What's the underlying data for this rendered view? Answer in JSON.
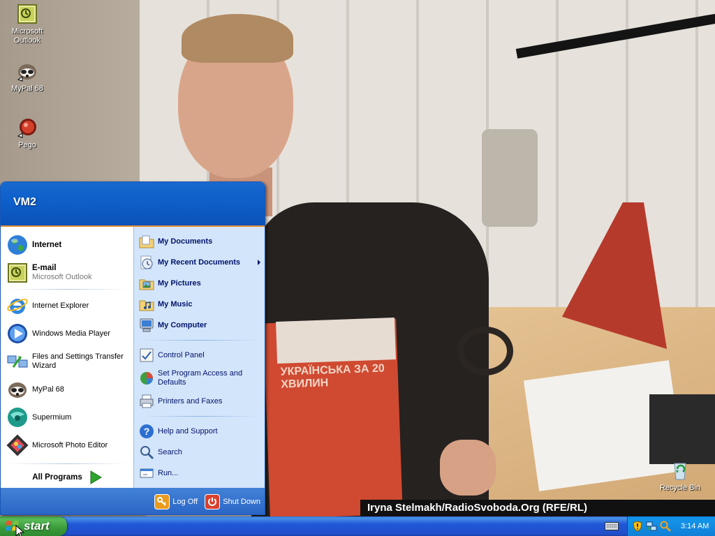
{
  "desktop": {
    "wallpaper_caption": "Iryna Stelmakh/RadioSvoboda.Org (RFE/RL)",
    "wallpaper_book_title": "УКРАЇНСЬКА ЗА 20 ХВИЛИН",
    "icons": [
      {
        "label": "Microsoft Outlook",
        "icon": "outlook-icon"
      },
      {
        "label": "MyPal 68",
        "icon": "mypal-icon"
      },
      {
        "label": "Pego",
        "icon": "pego-icon"
      },
      {
        "label": "Recycle Bin",
        "icon": "recycle-bin-icon"
      }
    ]
  },
  "start_menu": {
    "user_name": "VM2",
    "pinned": [
      {
        "label": "Internet",
        "icon": "globe-icon"
      },
      {
        "label": "E-mail",
        "sublabel": "Microsoft Outlook",
        "icon": "outlook-icon"
      }
    ],
    "recent": [
      {
        "label": "Internet Explorer",
        "icon": "internet-explorer-icon"
      },
      {
        "label": "Windows Media Player",
        "icon": "media-player-icon"
      },
      {
        "label": "Files and Settings Transfer Wizard",
        "icon": "transfer-wizard-icon"
      },
      {
        "label": "MyPal 68",
        "icon": "mypal-icon"
      },
      {
        "label": "Supermium",
        "icon": "supermium-icon"
      },
      {
        "label": "Microsoft Photo Editor",
        "icon": "photo-editor-icon"
      }
    ],
    "all_programs": "All Programs",
    "places": [
      {
        "label": "My Documents",
        "icon": "my-documents-icon"
      },
      {
        "label": "My Recent Documents",
        "icon": "recent-documents-icon",
        "submenu": true
      },
      {
        "label": "My Pictures",
        "icon": "my-pictures-icon"
      },
      {
        "label": "My Music",
        "icon": "my-music-icon"
      },
      {
        "label": "My Computer",
        "icon": "my-computer-icon"
      }
    ],
    "settings": [
      {
        "label": "Control Panel",
        "icon": "control-panel-icon"
      },
      {
        "label": "Set Program Access and Defaults",
        "icon": "program-access-icon"
      },
      {
        "label": "Printers and Faxes",
        "icon": "printer-icon"
      }
    ],
    "tools": [
      {
        "label": "Help and Support",
        "icon": "help-icon"
      },
      {
        "label": "Search",
        "icon": "search-icon"
      },
      {
        "label": "Run...",
        "icon": "run-icon"
      }
    ],
    "footer": {
      "log_off": "Log Off",
      "shut_down": "Shut Down"
    }
  },
  "taskbar": {
    "start_label": "start",
    "clock": "3:14 AM",
    "tray_icons": [
      "security-shield-icon",
      "network-icon",
      "search-tray-icon"
    ]
  },
  "colors": {
    "menu_header": "#0e60cb",
    "menu_right_pane": "#d3e5fa",
    "taskbar": "#2157d7",
    "start_button": "#3a9a3a",
    "tray": "#0f7fd7"
  }
}
